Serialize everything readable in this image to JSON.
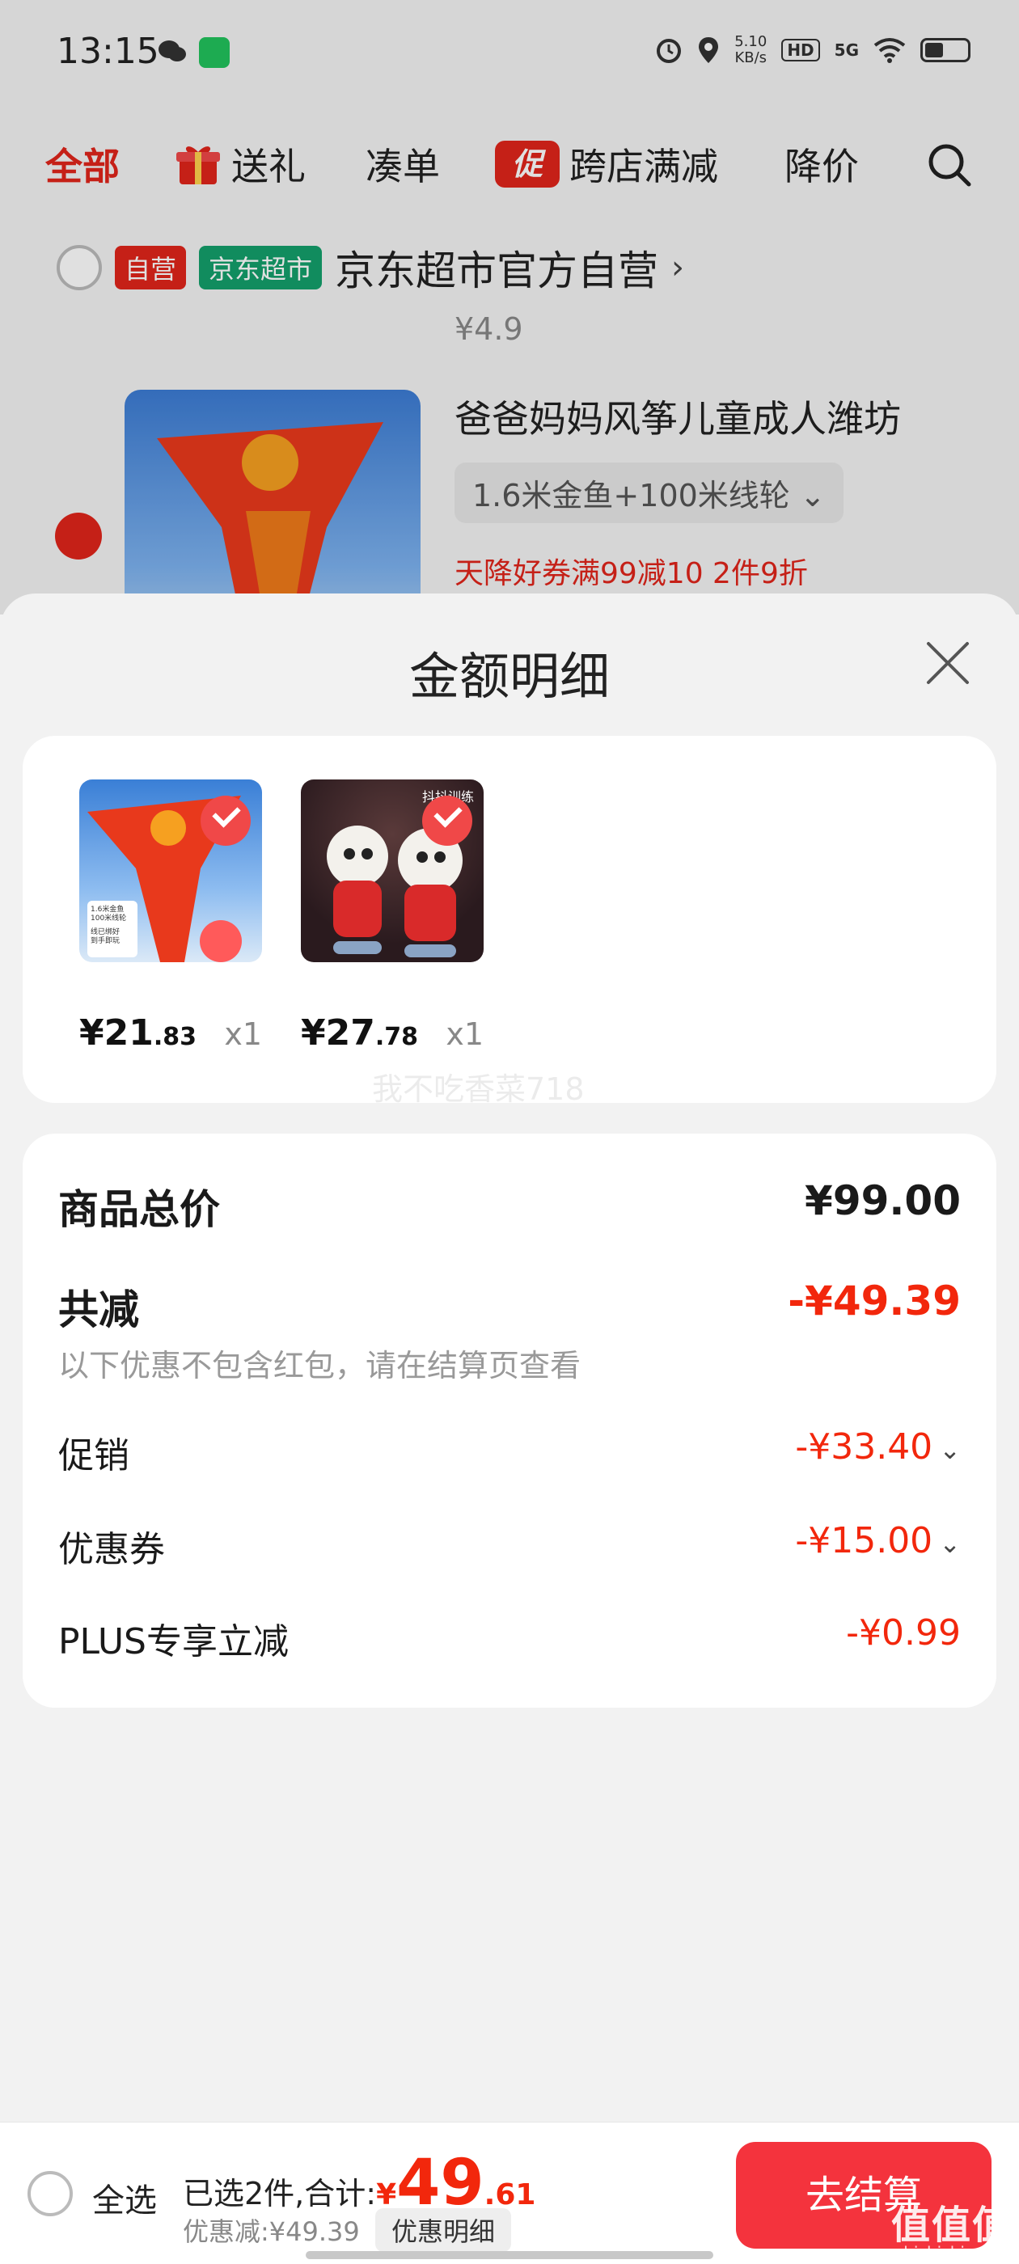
{
  "status": {
    "time": "13:15",
    "speed_value": "5.10",
    "speed_unit": "KB/s",
    "hd": "HD",
    "net": "5G"
  },
  "tabs": [
    {
      "label": "全部"
    },
    {
      "label": "送礼"
    },
    {
      "label": "凑单"
    },
    {
      "label": "跨店满减",
      "badge": "促"
    },
    {
      "label": "降价"
    }
  ],
  "background_cart": {
    "tag_self": "自营",
    "tag_market": "京东超市",
    "shop_name": "京东超市官方自营",
    "shop_chevron": "›",
    "small_price": "¥4.9",
    "product_title": "爸爸妈妈风筝儿童成人潍坊",
    "product_spec": "1.6米金鱼+100米线轮",
    "spec_chevron": "⌄",
    "coupon_text": "天降好券满99减10  2件9折"
  },
  "sheet": {
    "title": "金额明细",
    "products": [
      {
        "price_int": "¥21",
        "price_dec": ".83",
        "qty": "x1",
        "image": "kite-goldfish",
        "image_text_1": "1.6米金鱼",
        "image_text_2": "100米线轮",
        "image_text_3": "线已绑好",
        "image_text_4": "到手即玩"
      },
      {
        "price_int": "¥27",
        "price_dec": ".78",
        "qty": "x1",
        "image": "lion-dance-toys",
        "image_text_1": "抖抖训练"
      }
    ],
    "watermark": "我不吃香菜718",
    "detail": {
      "total_label": "商品总价",
      "total_value": "¥99.00",
      "reduce_label": "共减",
      "reduce_value": "-¥49.39",
      "reduce_note": "以下优惠不包含红包，请在结算页查看",
      "promo_label": "促销",
      "promo_value": "-¥33.40",
      "coupon_label": "优惠券",
      "coupon_value": "-¥15.00",
      "plus_label": "PLUS专享立减",
      "plus_value": "-¥0.99"
    }
  },
  "bottom": {
    "select_all": "全选",
    "summary_label": "已选2件,合计:",
    "currency": "¥",
    "total_int": "49",
    "total_dec": ".61",
    "discount_text": "优惠减:¥49.39",
    "detail_button": "优惠明细",
    "checkout_button": "去结算"
  },
  "corner_watermark": {
    "main": "值值值",
    "sub": "zhizhizhi.com"
  },
  "colors": {
    "accent": "#e1251b",
    "price_red": "#f2270c",
    "checkout": "#f4333d",
    "green_tag": "#14a06b"
  }
}
